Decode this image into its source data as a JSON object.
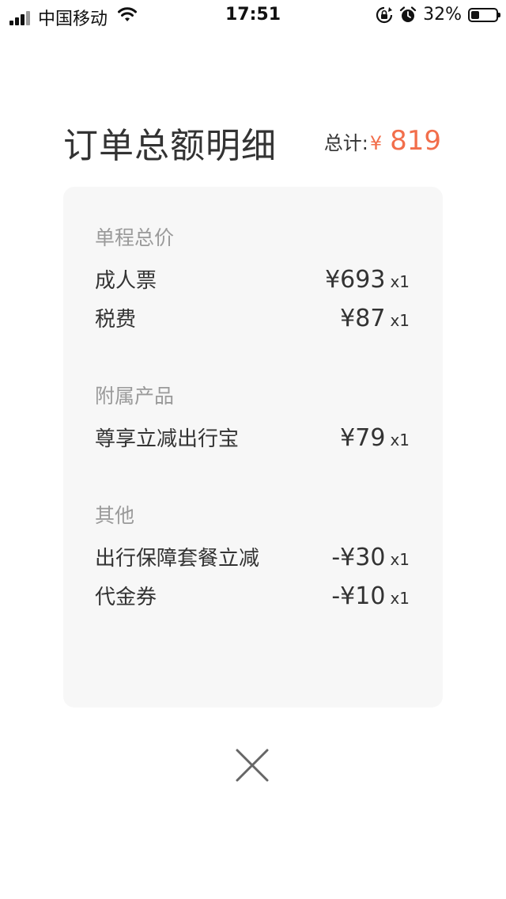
{
  "status_bar": {
    "carrier": "中国移动",
    "time": "17:51",
    "battery_percent": "32%",
    "battery_level": 0.32,
    "icons": [
      "signal-icon",
      "wifi-icon",
      "rotation-lock-icon",
      "alarm-icon",
      "battery-icon"
    ]
  },
  "header": {
    "title": "订单总额明细",
    "total_label": "总计:",
    "total_currency": "¥",
    "total_value": "819",
    "accent_color": "#f26e4b"
  },
  "sections": [
    {
      "title": "单程总价",
      "items": [
        {
          "label": "成人票",
          "amount": "¥693",
          "qty": "x1"
        },
        {
          "label": "税费",
          "amount": "¥87",
          "qty": "x1"
        }
      ]
    },
    {
      "title": "附属产品",
      "items": [
        {
          "label": "尊享立减出行宝",
          "amount": "¥79",
          "qty": "x1"
        }
      ]
    },
    {
      "title": "其他",
      "items": [
        {
          "label": "出行保障套餐立减",
          "amount": "-¥30",
          "qty": "x1"
        },
        {
          "label": "代金券",
          "amount": "-¥10",
          "qty": "x1"
        }
      ]
    }
  ],
  "close": {
    "icon": "close-icon"
  }
}
